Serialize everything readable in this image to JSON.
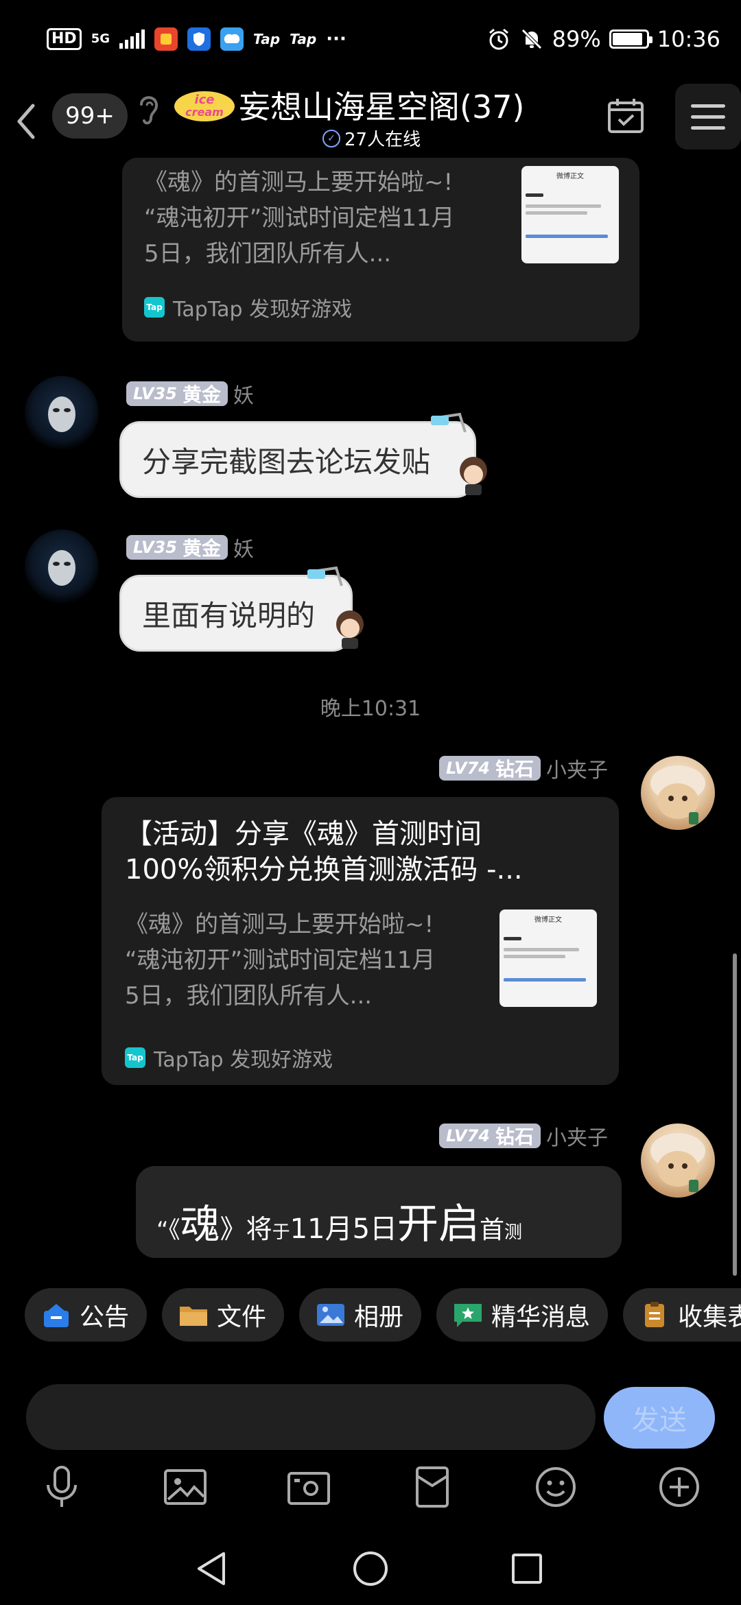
{
  "status_bar": {
    "hd": "HD",
    "net": "5G",
    "tap_label": "Tap",
    "tap_label_2": "Tap",
    "more": "···",
    "battery_pct": "89%",
    "battery_level": 0.89,
    "time": "10:36"
  },
  "header": {
    "unread": "99+",
    "logo_text": "ice cream",
    "group_name": "妄想山海星空阁(37)",
    "online": "27人在线"
  },
  "messages": {
    "top_card": {
      "desc": [
        "《魂》的首测马上要开始啦~!",
        "“魂沌初开”测试时间定档11月",
        "5日，我们团队所有人..."
      ],
      "source": "TapTap 发现好游戏",
      "thumb_title": "微博正文"
    },
    "msg1": {
      "level": "LV35",
      "rank": "黄金",
      "sender": "妖",
      "text": "分享完截图去论坛发贴"
    },
    "msg2": {
      "level": "LV35",
      "rank": "黄金",
      "sender": "妖",
      "text": "里面有说明的"
    },
    "time_divider": "晚上10:31",
    "msg3": {
      "level": "LV74",
      "rank": "钻石",
      "sender": "小夹子",
      "title": [
        "【活动】分享《魂》首测时间",
        "100%领积分兑换首测激活码 -..."
      ],
      "desc": [
        "《魂》的首测马上要开始啦~!",
        "“魂沌初开”测试时间定档11月",
        "5日，我们团队所有人..."
      ],
      "source": "TapTap 发现好游戏",
      "thumb_title": "微博正文"
    },
    "msg4": {
      "level": "LV74",
      "rank": "钻石",
      "sender": "小夹子",
      "parts": [
        "“《",
        "魂",
        "》将",
        "于",
        "11月5日",
        "开启",
        "首",
        "测"
      ]
    }
  },
  "chips": [
    {
      "label": "公告",
      "color": "#2b7de9"
    },
    {
      "label": "文件",
      "color": "#d89a3b"
    },
    {
      "label": "相册",
      "color": "#3a7ad6"
    },
    {
      "label": "精华消息",
      "color": "#2aa56b"
    },
    {
      "label": "收集表",
      "color": "#c98a2e"
    }
  ],
  "input": {
    "value": "",
    "send_label": "发送"
  },
  "toolbar": [
    "microphone-icon",
    "image-icon",
    "camera-icon",
    "red-packet-icon",
    "emoji-icon",
    "plus-icon"
  ],
  "navbar": [
    "back-icon",
    "home-icon",
    "recents-icon"
  ]
}
